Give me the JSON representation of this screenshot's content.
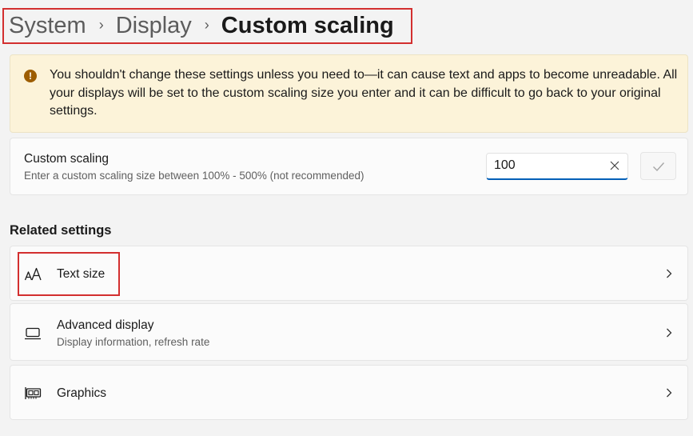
{
  "breadcrumb": {
    "items": [
      "System",
      "Display"
    ],
    "separator": "›",
    "current": "Custom scaling"
  },
  "warning": {
    "icon": "warning-icon",
    "icon_glyph": "!",
    "text": "You shouldn't change these settings unless you need to—it can cause text and apps to become unreadable. All your displays will be set to the custom scaling size you enter and it can be difficult to go back to your original settings."
  },
  "custom_scaling": {
    "title": "Custom scaling",
    "description": "Enter a custom scaling size between 100% - 500% (not recommended)",
    "input_value": "100"
  },
  "related_settings": {
    "title": "Related settings",
    "items": [
      {
        "label": "Text size",
        "description": "",
        "icon": "text-size-icon"
      },
      {
        "label": "Advanced display",
        "description": "Display information, refresh rate",
        "icon": "monitor-icon"
      },
      {
        "label": "Graphics",
        "description": "",
        "icon": "graphics-card-icon"
      }
    ]
  },
  "colors": {
    "accent": "#005fb8",
    "warning_bg": "#fcf3d9",
    "warning_icon": "#9d5d00",
    "annotation": "#d32f2f"
  }
}
